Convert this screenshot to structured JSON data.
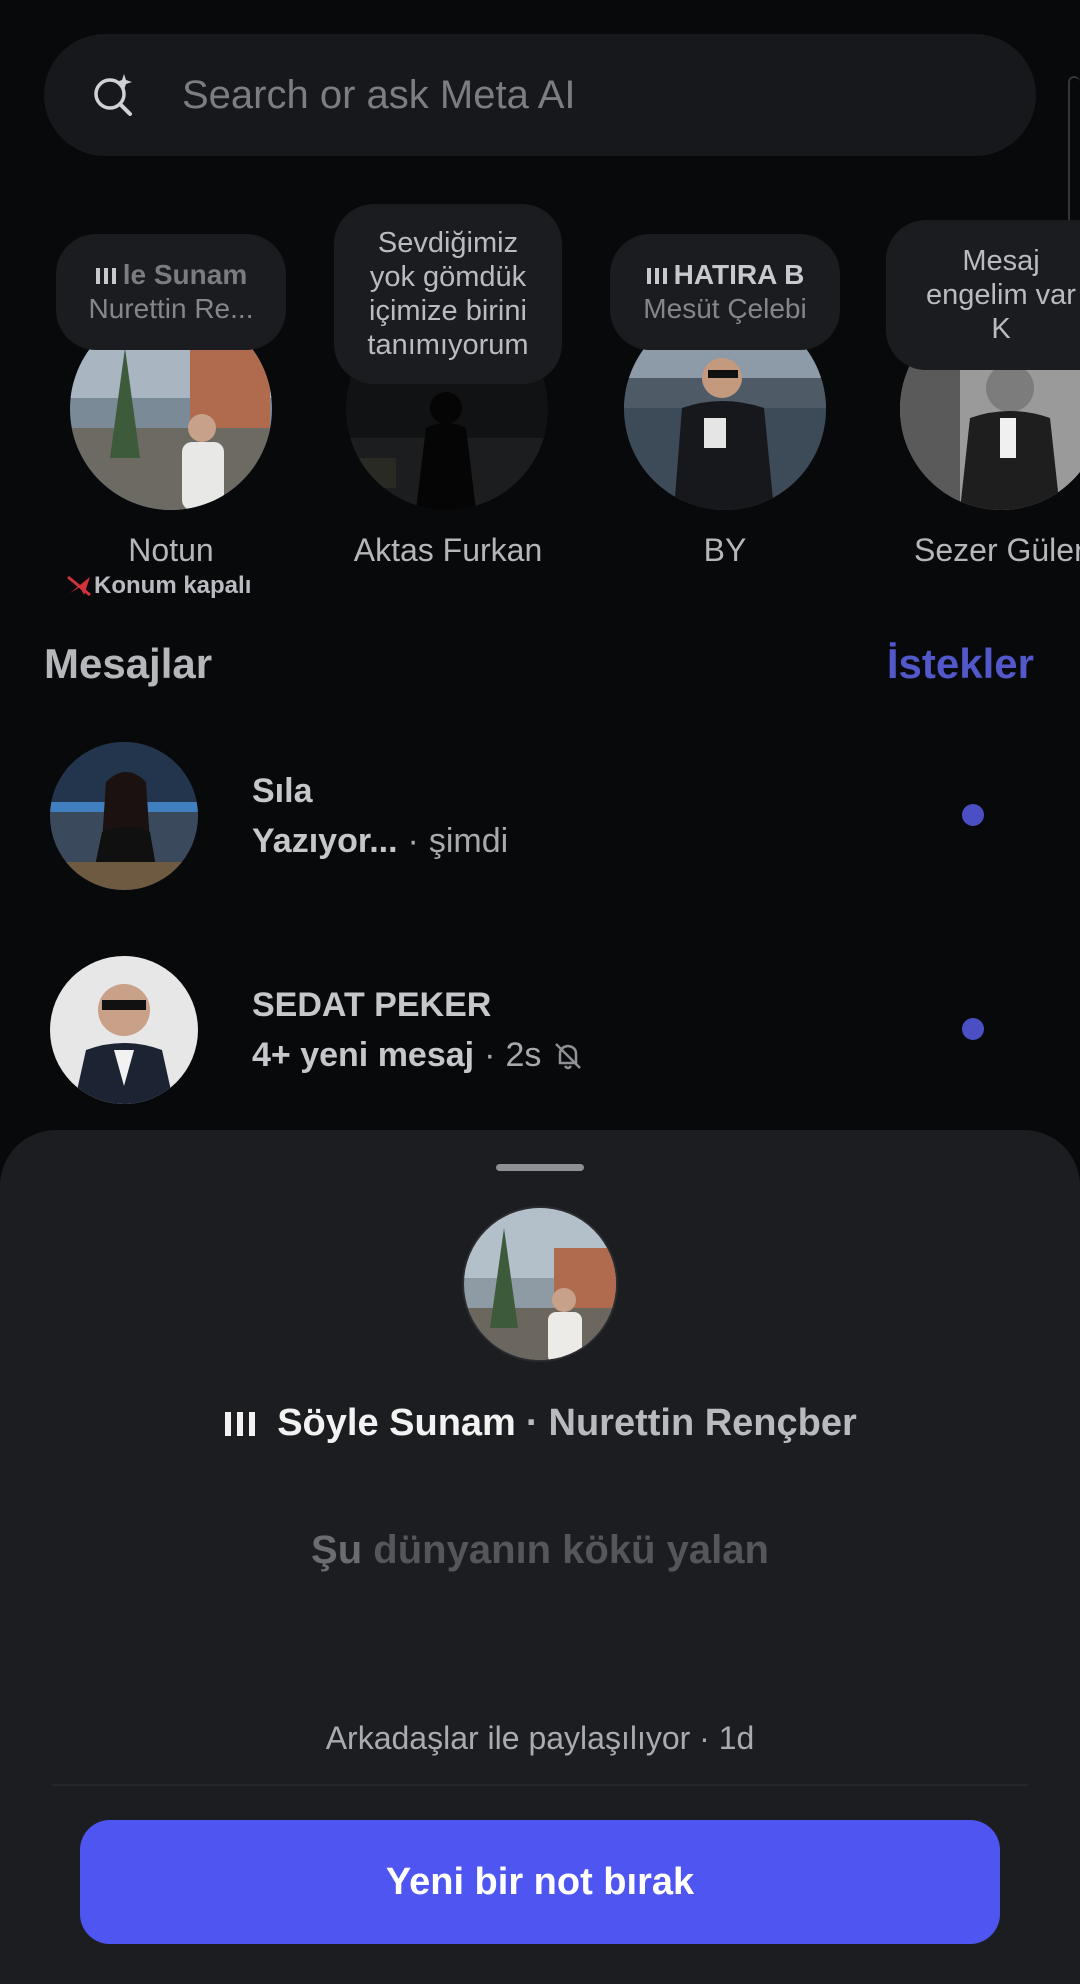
{
  "search": {
    "placeholder": "Search or ask Meta AI"
  },
  "notes": [
    {
      "music_title": "le Sunam",
      "artist": "Nurettin Re...",
      "name": "Notun",
      "status": "Konum kapalı"
    },
    {
      "text_lines": [
        "Sevdiğimiz",
        "yok gömdük",
        "içimize birini",
        "tanımıyorum"
      ],
      "name": "Aktas Furkan"
    },
    {
      "music_title": "HATIRA B",
      "artist": "Mesüt Çelebi",
      "name": "BY"
    },
    {
      "text_lines": [
        "Mesaj",
        "engelim var",
        "K"
      ],
      "name": "Sezer Güler"
    }
  ],
  "messages_header": {
    "title": "Mesajlar",
    "requests": "İstekler"
  },
  "threads": [
    {
      "name": "Sıla",
      "status": "Yazıyor...",
      "sep": "·",
      "time": "şimdi"
    },
    {
      "name": "SEDAT PEKER",
      "status": "4+ yeni mesaj",
      "sep": "·",
      "time": "2s"
    }
  ],
  "sheet": {
    "song": "Söyle Sunam",
    "sep": "·",
    "artist": "Nurettin Rençber",
    "lyric_first": "Şu",
    "lyric_rest": "dünyanın kökü yalan",
    "shared": "Arkadaşlar ile paylaşılıyor · 1d",
    "cta": "Yeni bir not bırak"
  },
  "colors": {
    "accent": "#4f55f0",
    "requests": "#5257c9",
    "unread_dot": "#4a4fc4"
  },
  "icons": [
    "meta-ai-search-icon",
    "music-bars-icon",
    "location-off-icon",
    "muted-bell-icon"
  ]
}
